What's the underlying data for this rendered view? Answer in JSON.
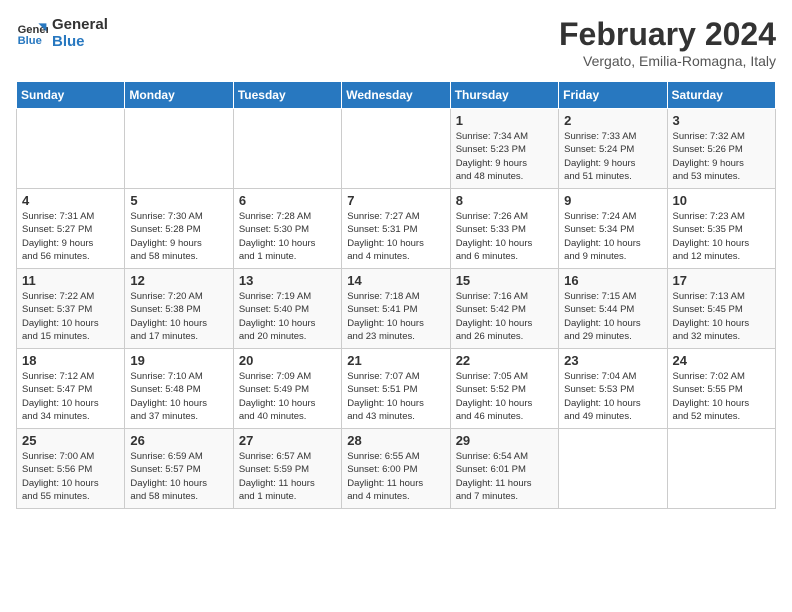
{
  "logo": {
    "line1": "General",
    "line2": "Blue"
  },
  "title": "February 2024",
  "subtitle": "Vergato, Emilia-Romagna, Italy",
  "days_of_week": [
    "Sunday",
    "Monday",
    "Tuesday",
    "Wednesday",
    "Thursday",
    "Friday",
    "Saturday"
  ],
  "weeks": [
    [
      {
        "day": "",
        "info": ""
      },
      {
        "day": "",
        "info": ""
      },
      {
        "day": "",
        "info": ""
      },
      {
        "day": "",
        "info": ""
      },
      {
        "day": "1",
        "info": "Sunrise: 7:34 AM\nSunset: 5:23 PM\nDaylight: 9 hours\nand 48 minutes."
      },
      {
        "day": "2",
        "info": "Sunrise: 7:33 AM\nSunset: 5:24 PM\nDaylight: 9 hours\nand 51 minutes."
      },
      {
        "day": "3",
        "info": "Sunrise: 7:32 AM\nSunset: 5:26 PM\nDaylight: 9 hours\nand 53 minutes."
      }
    ],
    [
      {
        "day": "4",
        "info": "Sunrise: 7:31 AM\nSunset: 5:27 PM\nDaylight: 9 hours\nand 56 minutes."
      },
      {
        "day": "5",
        "info": "Sunrise: 7:30 AM\nSunset: 5:28 PM\nDaylight: 9 hours\nand 58 minutes."
      },
      {
        "day": "6",
        "info": "Sunrise: 7:28 AM\nSunset: 5:30 PM\nDaylight: 10 hours\nand 1 minute."
      },
      {
        "day": "7",
        "info": "Sunrise: 7:27 AM\nSunset: 5:31 PM\nDaylight: 10 hours\nand 4 minutes."
      },
      {
        "day": "8",
        "info": "Sunrise: 7:26 AM\nSunset: 5:33 PM\nDaylight: 10 hours\nand 6 minutes."
      },
      {
        "day": "9",
        "info": "Sunrise: 7:24 AM\nSunset: 5:34 PM\nDaylight: 10 hours\nand 9 minutes."
      },
      {
        "day": "10",
        "info": "Sunrise: 7:23 AM\nSunset: 5:35 PM\nDaylight: 10 hours\nand 12 minutes."
      }
    ],
    [
      {
        "day": "11",
        "info": "Sunrise: 7:22 AM\nSunset: 5:37 PM\nDaylight: 10 hours\nand 15 minutes."
      },
      {
        "day": "12",
        "info": "Sunrise: 7:20 AM\nSunset: 5:38 PM\nDaylight: 10 hours\nand 17 minutes."
      },
      {
        "day": "13",
        "info": "Sunrise: 7:19 AM\nSunset: 5:40 PM\nDaylight: 10 hours\nand 20 minutes."
      },
      {
        "day": "14",
        "info": "Sunrise: 7:18 AM\nSunset: 5:41 PM\nDaylight: 10 hours\nand 23 minutes."
      },
      {
        "day": "15",
        "info": "Sunrise: 7:16 AM\nSunset: 5:42 PM\nDaylight: 10 hours\nand 26 minutes."
      },
      {
        "day": "16",
        "info": "Sunrise: 7:15 AM\nSunset: 5:44 PM\nDaylight: 10 hours\nand 29 minutes."
      },
      {
        "day": "17",
        "info": "Sunrise: 7:13 AM\nSunset: 5:45 PM\nDaylight: 10 hours\nand 32 minutes."
      }
    ],
    [
      {
        "day": "18",
        "info": "Sunrise: 7:12 AM\nSunset: 5:47 PM\nDaylight: 10 hours\nand 34 minutes."
      },
      {
        "day": "19",
        "info": "Sunrise: 7:10 AM\nSunset: 5:48 PM\nDaylight: 10 hours\nand 37 minutes."
      },
      {
        "day": "20",
        "info": "Sunrise: 7:09 AM\nSunset: 5:49 PM\nDaylight: 10 hours\nand 40 minutes."
      },
      {
        "day": "21",
        "info": "Sunrise: 7:07 AM\nSunset: 5:51 PM\nDaylight: 10 hours\nand 43 minutes."
      },
      {
        "day": "22",
        "info": "Sunrise: 7:05 AM\nSunset: 5:52 PM\nDaylight: 10 hours\nand 46 minutes."
      },
      {
        "day": "23",
        "info": "Sunrise: 7:04 AM\nSunset: 5:53 PM\nDaylight: 10 hours\nand 49 minutes."
      },
      {
        "day": "24",
        "info": "Sunrise: 7:02 AM\nSunset: 5:55 PM\nDaylight: 10 hours\nand 52 minutes."
      }
    ],
    [
      {
        "day": "25",
        "info": "Sunrise: 7:00 AM\nSunset: 5:56 PM\nDaylight: 10 hours\nand 55 minutes."
      },
      {
        "day": "26",
        "info": "Sunrise: 6:59 AM\nSunset: 5:57 PM\nDaylight: 10 hours\nand 58 minutes."
      },
      {
        "day": "27",
        "info": "Sunrise: 6:57 AM\nSunset: 5:59 PM\nDaylight: 11 hours\nand 1 minute."
      },
      {
        "day": "28",
        "info": "Sunrise: 6:55 AM\nSunset: 6:00 PM\nDaylight: 11 hours\nand 4 minutes."
      },
      {
        "day": "29",
        "info": "Sunrise: 6:54 AM\nSunset: 6:01 PM\nDaylight: 11 hours\nand 7 minutes."
      },
      {
        "day": "",
        "info": ""
      },
      {
        "day": "",
        "info": ""
      }
    ]
  ]
}
